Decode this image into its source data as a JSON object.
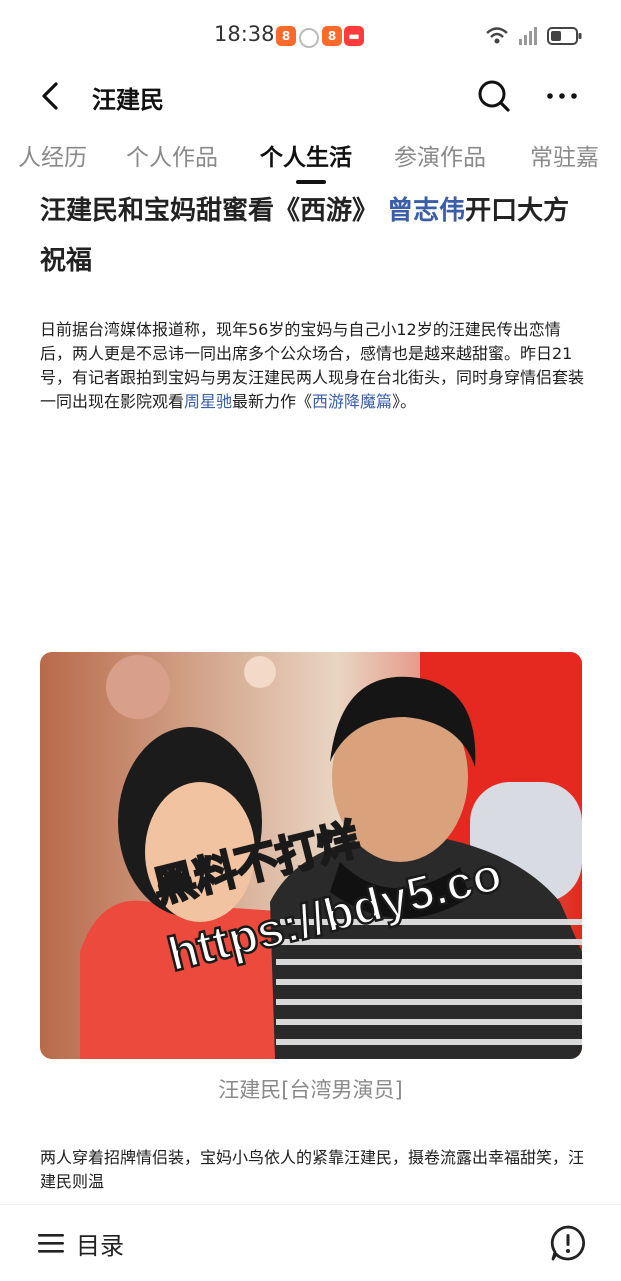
{
  "status": {
    "time": "18:38",
    "app_icons": [
      "app-icon-1",
      "app-icon-2",
      "app-icon-3"
    ],
    "battery": "battery-icon"
  },
  "header": {
    "title": "汪建民"
  },
  "tabs": [
    "人经历",
    "个人作品",
    "个人生活",
    "参演作品",
    "常驻嘉"
  ],
  "active_tab": "个人生活",
  "article": {
    "heading_pre": "汪建民和宝妈甜蜜看《西游》",
    "heading_link": "曾志伟",
    "heading_post": "开口大方祝福",
    "p1_text_a": "日前据台湾媒体报道称，现年56岁的宝妈与自己小12岁的汪建民传出恋情后，两人更是不忌讳一同出席多个公众场合，感情也是越来越甜蜜。昨日21号，有记者跟拍到宝妈与男友汪建民两人现身在台北街头，同时身穿情侣套装一同出现在影院观看",
    "p1_link_a": "周星驰",
    "p1_text_b": "最新力作《",
    "p1_link_b": "西游降魔篇",
    "p1_text_c": "》。",
    "image_watermark": [
      "黑料不打烊",
      "https://bdy5.co"
    ],
    "caption": "汪建民[台湾男演员]",
    "p2_text": "两人穿着招牌情侣装，宝妈小鸟依人的紧靠汪建民，摄卷流露出幸福甜笑，汪建民则温"
  },
  "bottom": {
    "toc_label": "目录"
  },
  "colors": {
    "link": "#3a5ea8",
    "tab_inactive": "#8a8a8a",
    "app_badge": "#ff6a2a"
  }
}
